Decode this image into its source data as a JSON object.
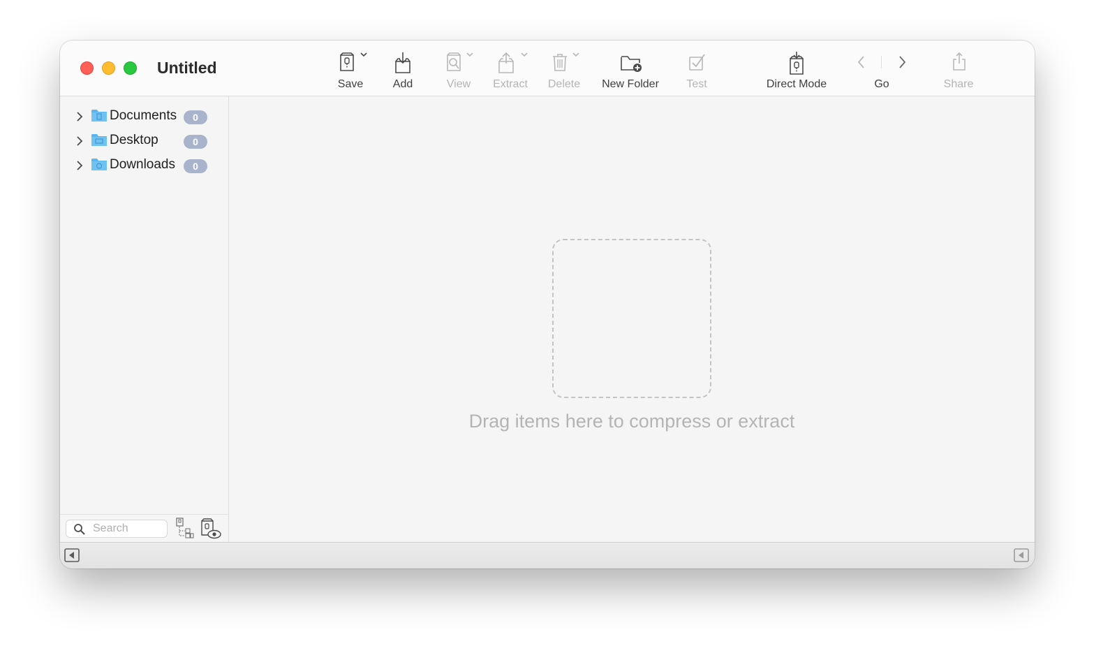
{
  "window": {
    "title": "Untitled"
  },
  "toolbar": {
    "items": [
      {
        "label": "Save",
        "icon": "archive-icon",
        "enabled": true,
        "menu": true
      },
      {
        "label": "Add",
        "icon": "add-icon",
        "enabled": true,
        "menu": false
      },
      {
        "label": "View",
        "icon": "view-icon",
        "enabled": false,
        "menu": true
      },
      {
        "label": "Extract",
        "icon": "extract-icon",
        "enabled": false,
        "menu": true
      },
      {
        "label": "Delete",
        "icon": "trash-icon",
        "enabled": false,
        "menu": true
      },
      {
        "label": "New Folder",
        "icon": "new-folder-icon",
        "enabled": true,
        "menu": false
      },
      {
        "label": "Test",
        "icon": "checkbox-icon",
        "enabled": false,
        "menu": false
      },
      {
        "label": "Direct Mode",
        "icon": "direct-mode-icon",
        "enabled": true,
        "menu": false
      },
      {
        "label": "Go",
        "icon": "back-forward-icon",
        "enabled": true,
        "menu": false
      },
      {
        "label": "Share",
        "icon": "share-icon",
        "enabled": false,
        "menu": false
      }
    ]
  },
  "sidebar": {
    "items": [
      {
        "name": "Documents",
        "count": "0",
        "icon": "documents-folder-icon"
      },
      {
        "name": "Desktop",
        "count": "0",
        "icon": "desktop-folder-icon"
      },
      {
        "name": "Downloads",
        "count": "0",
        "icon": "downloads-folder-icon"
      }
    ],
    "search": {
      "placeholder": "Search",
      "value": ""
    }
  },
  "main": {
    "drop_message": "Drag items here to compress or extract"
  },
  "colors": {
    "accent": "#4aa8e8",
    "badge": "#a8b4cc",
    "close": "#fe5f57",
    "minimize": "#febc2e",
    "maximize": "#28c840"
  }
}
